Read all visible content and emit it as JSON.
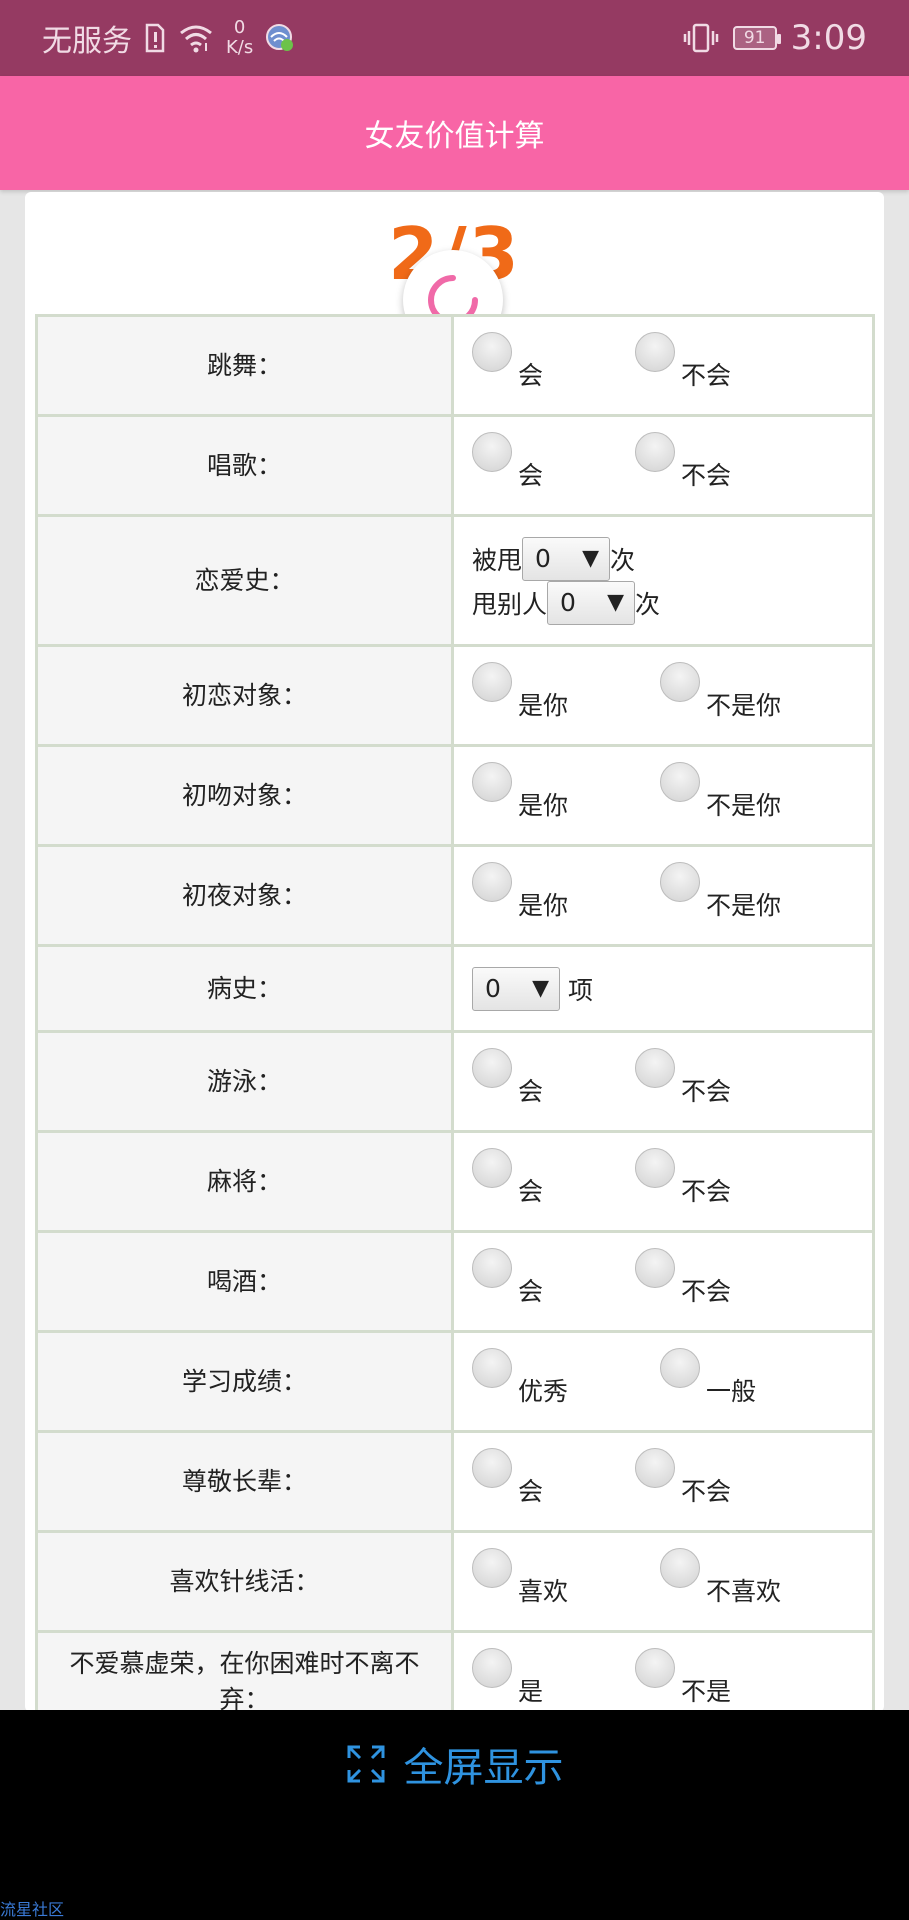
{
  "status_bar": {
    "carrier": "无服务",
    "net_speed_value": "0",
    "net_speed_unit": "K/s",
    "battery": "91",
    "time": "3:09"
  },
  "app": {
    "title": "女友价值计算"
  },
  "progress": {
    "text": "2/3"
  },
  "rows": [
    {
      "label": "跳舞：",
      "options": [
        "会",
        "不会"
      ]
    },
    {
      "label": "唱歌：",
      "options": [
        "会",
        "不会"
      ]
    },
    {
      "label": "恋爱史：",
      "dumped_prefix": "被甩",
      "dumped_value": "0",
      "dumped_suffix": "次",
      "dumper_prefix": "甩别人",
      "dumper_value": "0",
      "dumper_suffix": "次"
    },
    {
      "label": "初恋对象：",
      "options": [
        "是你",
        "不是你"
      ]
    },
    {
      "label": "初吻对象：",
      "options": [
        "是你",
        "不是你"
      ]
    },
    {
      "label": "初夜对象：",
      "options": [
        "是你",
        "不是你"
      ]
    },
    {
      "label": "病史：",
      "select_value": "0",
      "suffix": "项"
    },
    {
      "label": "游泳：",
      "options": [
        "会",
        "不会"
      ]
    },
    {
      "label": "麻将：",
      "options": [
        "会",
        "不会"
      ]
    },
    {
      "label": "喝酒：",
      "options": [
        "会",
        "不会"
      ]
    },
    {
      "label": "学习成绩：",
      "options": [
        "优秀",
        "一般"
      ]
    },
    {
      "label": "尊敬长辈：",
      "options": [
        "会",
        "不会"
      ]
    },
    {
      "label": "喜欢针线活：",
      "options": [
        "喜欢",
        "不喜欢"
      ]
    },
    {
      "label": "不爱慕虚荣，在你困难时不离不弃：",
      "options": [
        "是",
        "不是"
      ]
    }
  ],
  "bottom": {
    "fullscreen_label": "全屏显示",
    "watermark": "流星社区"
  },
  "colors": {
    "status_bar": "#953a62",
    "app_bar": "#f865a6",
    "progress": "#f06a18",
    "link_blue": "#2f93e0"
  }
}
